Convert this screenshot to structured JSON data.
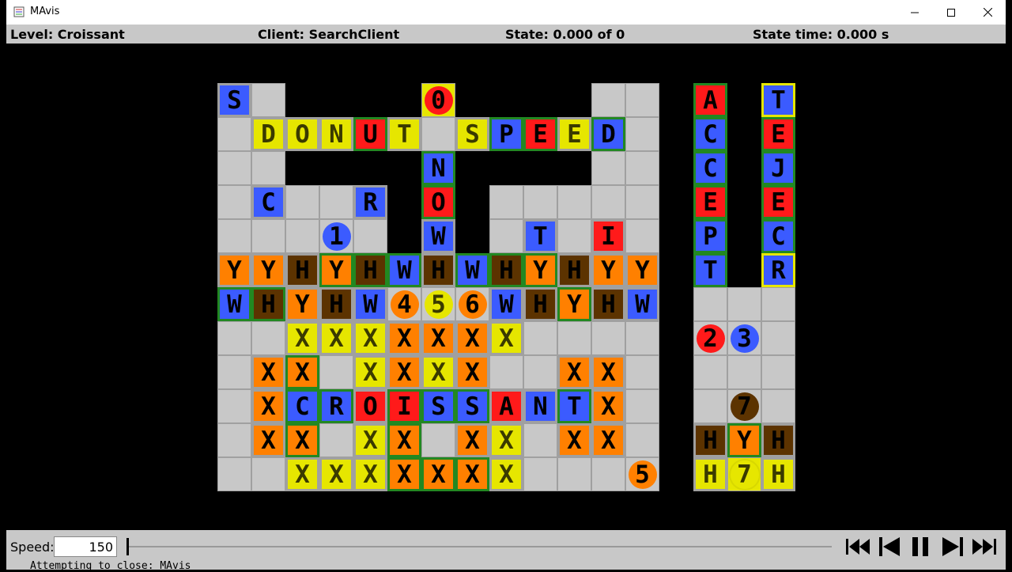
{
  "window": {
    "title": "MAvis",
    "minimize_symbol": "—",
    "maximize_symbol": "☐",
    "close_symbol": "✕"
  },
  "status": {
    "level": "Level: Croissant",
    "client": "Client: SearchClient",
    "state": "State: 0.000 of 0",
    "state_time": "State time: 0.000 s"
  },
  "controls": {
    "speed_label": "Speed:",
    "speed_value": "150",
    "slider_position": 0,
    "buttons": [
      "skip-to-start-icon",
      "step-back-icon",
      "pause-icon",
      "step-forward-icon",
      "skip-to-end-icon"
    ]
  },
  "console": {
    "text": "Attempting to close: MAvis"
  },
  "colors": {
    "free": "#c8c8c8",
    "wall": "#000000",
    "blue": "#3b5bff",
    "red": "#ff1a1a",
    "orange": "#ff8000",
    "yellow": "#e6e600",
    "brown": "#5c3300",
    "border_green": "#228822",
    "status_bar": "#c8c8c8"
  },
  "grid": {
    "rows": [
      "S....0....W...B..W",
      "DONUT.SPEED..C..E",
      "......N.......C..J",
      ".C..R.O.....E..E",
      "..1.W.TI.....P..C",
      "YYHYHWHWHYHYY.T..R",
      "WHYHW456WHYHW......",
      "..XXXXXXX.....23.",
      ".XX.XXXX..XX.......",
      ".XCROISSANTX...7.",
      ".XX.XX.XX.XX.HYH",
      "..XXXXXXX...5.H7H"
    ]
  },
  "boxes": [
    {
      "r": 0,
      "c": 0,
      "t": "S",
      "color": "blue",
      "goal": false
    },
    {
      "r": 1,
      "c": 1,
      "t": "D",
      "color": "yellow",
      "goal": false
    },
    {
      "r": 1,
      "c": 2,
      "t": "O",
      "color": "yellow",
      "goal": false
    },
    {
      "r": 1,
      "c": 3,
      "t": "N",
      "color": "yellow",
      "goal": false
    },
    {
      "r": 1,
      "c": 4,
      "t": "U",
      "color": "red",
      "goal": true
    },
    {
      "r": 1,
      "c": 5,
      "t": "T",
      "color": "yellow",
      "goal": false
    },
    {
      "r": 1,
      "c": 7,
      "t": "S",
      "color": "yellow",
      "goal": false
    },
    {
      "r": 1,
      "c": 8,
      "t": "P",
      "color": "blue",
      "goal": true
    },
    {
      "r": 1,
      "c": 9,
      "t": "E",
      "color": "red",
      "goal": true
    },
    {
      "r": 1,
      "c": 10,
      "t": "E",
      "color": "yellow",
      "goal": false
    },
    {
      "r": 1,
      "c": 11,
      "t": "D",
      "color": "blue",
      "goal": true
    },
    {
      "r": 2,
      "c": 6,
      "t": "N",
      "color": "blue",
      "goal": true
    },
    {
      "r": 3,
      "c": 1,
      "t": "C",
      "color": "blue",
      "goal": false
    },
    {
      "r": 3,
      "c": 4,
      "t": "R",
      "color": "blue",
      "goal": false
    },
    {
      "r": 3,
      "c": 6,
      "t": "O",
      "color": "red",
      "goal": true
    },
    {
      "r": 4,
      "c": 6,
      "t": "W",
      "color": "blue",
      "goal": false
    },
    {
      "r": 4,
      "c": 9,
      "t": "T",
      "color": "blue",
      "goal": false
    },
    {
      "r": 4,
      "c": 11,
      "t": "I",
      "color": "red",
      "goal": false
    },
    {
      "r": 5,
      "c": 0,
      "t": "Y",
      "color": "orange",
      "goal": false
    },
    {
      "r": 5,
      "c": 1,
      "t": "Y",
      "color": "orange",
      "goal": false
    },
    {
      "r": 5,
      "c": 2,
      "t": "H",
      "color": "brown",
      "goal": false
    },
    {
      "r": 5,
      "c": 3,
      "t": "Y",
      "color": "orange",
      "goal": true
    },
    {
      "r": 5,
      "c": 4,
      "t": "H",
      "color": "brown",
      "goal": true
    },
    {
      "r": 5,
      "c": 5,
      "t": "W",
      "color": "blue",
      "goal": true
    },
    {
      "r": 5,
      "c": 6,
      "t": "H",
      "color": "brown",
      "goal": false
    },
    {
      "r": 5,
      "c": 7,
      "t": "W",
      "color": "blue",
      "goal": true
    },
    {
      "r": 5,
      "c": 8,
      "t": "H",
      "color": "brown",
      "goal": true
    },
    {
      "r": 5,
      "c": 9,
      "t": "Y",
      "color": "orange",
      "goal": true
    },
    {
      "r": 5,
      "c": 10,
      "t": "H",
      "color": "brown",
      "goal": false
    },
    {
      "r": 5,
      "c": 11,
      "t": "Y",
      "color": "orange",
      "goal": false
    },
    {
      "r": 5,
      "c": 12,
      "t": "Y",
      "color": "orange",
      "goal": false
    },
    {
      "r": 6,
      "c": 0,
      "t": "W",
      "color": "blue",
      "goal": true
    },
    {
      "r": 6,
      "c": 1,
      "t": "H",
      "color": "brown",
      "goal": true
    },
    {
      "r": 6,
      "c": 2,
      "t": "Y",
      "color": "orange",
      "goal": false
    },
    {
      "r": 6,
      "c": 3,
      "t": "H",
      "color": "brown",
      "goal": false
    },
    {
      "r": 6,
      "c": 4,
      "t": "W",
      "color": "blue",
      "goal": false
    },
    {
      "r": 6,
      "c": 8,
      "t": "W",
      "color": "blue",
      "goal": false
    },
    {
      "r": 6,
      "c": 9,
      "t": "H",
      "color": "brown",
      "goal": false
    },
    {
      "r": 6,
      "c": 10,
      "t": "Y",
      "color": "orange",
      "goal": true
    },
    {
      "r": 6,
      "c": 11,
      "t": "H",
      "color": "brown",
      "goal": false
    },
    {
      "r": 6,
      "c": 12,
      "t": "W",
      "color": "blue",
      "goal": false
    },
    {
      "r": 7,
      "c": 2,
      "t": "X",
      "color": "yellow",
      "goal": false
    },
    {
      "r": 7,
      "c": 3,
      "t": "X",
      "color": "yellow",
      "goal": false
    },
    {
      "r": 7,
      "c": 4,
      "t": "X",
      "color": "yellow",
      "goal": false
    },
    {
      "r": 7,
      "c": 5,
      "t": "X",
      "color": "orange",
      "goal": false
    },
    {
      "r": 7,
      "c": 6,
      "t": "X",
      "color": "orange",
      "goal": false
    },
    {
      "r": 7,
      "c": 7,
      "t": "X",
      "color": "orange",
      "goal": false
    },
    {
      "r": 7,
      "c": 8,
      "t": "X",
      "color": "yellow",
      "goal": false
    },
    {
      "r": 8,
      "c": 1,
      "t": "X",
      "color": "orange",
      "goal": false
    },
    {
      "r": 8,
      "c": 2,
      "t": "X",
      "color": "orange",
      "goal": true
    },
    {
      "r": 8,
      "c": 4,
      "t": "X",
      "color": "yellow",
      "goal": false
    },
    {
      "r": 8,
      "c": 5,
      "t": "X",
      "color": "orange",
      "goal": false
    },
    {
      "r": 8,
      "c": 6,
      "t": "X",
      "color": "yellow",
      "goal": false
    },
    {
      "r": 8,
      "c": 7,
      "t": "X",
      "color": "orange",
      "goal": false
    },
    {
      "r": 8,
      "c": 10,
      "t": "X",
      "color": "orange",
      "goal": false
    },
    {
      "r": 8,
      "c": 11,
      "t": "X",
      "color": "orange",
      "goal": false
    },
    {
      "r": 9,
      "c": 1,
      "t": "X",
      "color": "orange",
      "goal": false
    },
    {
      "r": 9,
      "c": 2,
      "t": "C",
      "color": "blue",
      "goal": true
    },
    {
      "r": 9,
      "c": 3,
      "t": "R",
      "color": "blue",
      "goal": true
    },
    {
      "r": 9,
      "c": 4,
      "t": "O",
      "color": "red",
      "goal": false
    },
    {
      "r": 9,
      "c": 5,
      "t": "I",
      "color": "red",
      "goal": true
    },
    {
      "r": 9,
      "c": 6,
      "t": "S",
      "color": "blue",
      "goal": true
    },
    {
      "r": 9,
      "c": 7,
      "t": "S",
      "color": "blue",
      "goal": true
    },
    {
      "r": 9,
      "c": 8,
      "t": "A",
      "color": "red",
      "goal": false
    },
    {
      "r": 9,
      "c": 9,
      "t": "N",
      "color": "blue",
      "goal": false
    },
    {
      "r": 9,
      "c": 10,
      "t": "T",
      "color": "blue",
      "goal": true
    },
    {
      "r": 9,
      "c": 11,
      "t": "X",
      "color": "orange",
      "goal": false
    },
    {
      "r": 10,
      "c": 1,
      "t": "X",
      "color": "orange",
      "goal": false
    },
    {
      "r": 10,
      "c": 2,
      "t": "X",
      "color": "orange",
      "goal": true
    },
    {
      "r": 10,
      "c": 4,
      "t": "X",
      "color": "yellow",
      "goal": false
    },
    {
      "r": 10,
      "c": 5,
      "t": "X",
      "color": "orange",
      "goal": true
    },
    {
      "r": 10,
      "c": 7,
      "t": "X",
      "color": "orange",
      "goal": false
    },
    {
      "r": 10,
      "c": 8,
      "t": "X",
      "color": "yellow",
      "goal": false
    },
    {
      "r": 10,
      "c": 10,
      "t": "X",
      "color": "orange",
      "goal": false
    },
    {
      "r": 10,
      "c": 11,
      "t": "X",
      "color": "orange",
      "goal": false
    },
    {
      "r": 11,
      "c": 2,
      "t": "X",
      "color": "yellow",
      "goal": false
    },
    {
      "r": 11,
      "c": 3,
      "t": "X",
      "color": "yellow",
      "goal": false
    },
    {
      "r": 11,
      "c": 4,
      "t": "X",
      "color": "yellow",
      "goal": false
    },
    {
      "r": 11,
      "c": 5,
      "t": "X",
      "color": "orange",
      "goal": true
    },
    {
      "r": 11,
      "c": 6,
      "t": "X",
      "color": "orange",
      "goal": true
    },
    {
      "r": 11,
      "c": 7,
      "t": "X",
      "color": "orange",
      "goal": true
    },
    {
      "r": 11,
      "c": 8,
      "t": "X",
      "color": "yellow",
      "goal": false
    },
    {
      "r": 0,
      "c": 14,
      "t": "A",
      "color": "red",
      "goal": true
    },
    {
      "r": 0,
      "c": 16,
      "t": "T",
      "color": "blue",
      "goal": false,
      "yellowBorder": true
    },
    {
      "r": 1,
      "c": 14,
      "t": "C",
      "color": "blue",
      "goal": true
    },
    {
      "r": 1,
      "c": 16,
      "t": "E",
      "color": "red",
      "goal": true
    },
    {
      "r": 2,
      "c": 14,
      "t": "C",
      "color": "blue",
      "goal": true
    },
    {
      "r": 2,
      "c": 16,
      "t": "J",
      "color": "blue",
      "goal": true
    },
    {
      "r": 3,
      "c": 14,
      "t": "E",
      "color": "red",
      "goal": true
    },
    {
      "r": 3,
      "c": 16,
      "t": "E",
      "color": "red",
      "goal": true
    },
    {
      "r": 4,
      "c": 14,
      "t": "P",
      "color": "blue",
      "goal": true
    },
    {
      "r": 4,
      "c": 16,
      "t": "C",
      "color": "blue",
      "goal": true
    },
    {
      "r": 5,
      "c": 14,
      "t": "T",
      "color": "blue",
      "goal": true
    },
    {
      "r": 5,
      "c": 16,
      "t": "R",
      "color": "blue",
      "goal": false,
      "yellowBorder": true
    },
    {
      "r": 10,
      "c": 14,
      "t": "H",
      "color": "brown",
      "goal": false
    },
    {
      "r": 10,
      "c": 15,
      "t": "Y",
      "color": "orange",
      "goal": true
    },
    {
      "r": 10,
      "c": 16,
      "t": "H",
      "color": "brown",
      "goal": false
    },
    {
      "r": 11,
      "c": 14,
      "t": "H",
      "color": "yellow",
      "goal": false
    },
    {
      "r": 11,
      "c": 16,
      "t": "H",
      "color": "yellow",
      "goal": false
    }
  ],
  "agents": [
    {
      "r": 0,
      "c": 6,
      "t": "0",
      "color": "red",
      "bg": "yellow"
    },
    {
      "r": 4,
      "c": 3,
      "t": "1",
      "color": "blue",
      "bg": "free"
    },
    {
      "r": 6,
      "c": 5,
      "t": "4",
      "color": "orange",
      "bg": "free"
    },
    {
      "r": 6,
      "c": 6,
      "t": "5",
      "color": "yellow",
      "bg": "free"
    },
    {
      "r": 6,
      "c": 7,
      "t": "6",
      "color": "orange",
      "bg": "free"
    },
    {
      "r": 11,
      "c": 12,
      "t": "5",
      "color": "orange",
      "bg": "free"
    },
    {
      "r": 7,
      "c": 14,
      "t": "2",
      "color": "red",
      "bg": "free"
    },
    {
      "r": 7,
      "c": 15,
      "t": "3",
      "color": "blue",
      "bg": "free"
    },
    {
      "r": 9,
      "c": 15,
      "t": "7",
      "color": "brown",
      "bg": "free"
    },
    {
      "r": 11,
      "c": 15,
      "t": "7",
      "color": "yellow",
      "bg": "yellow"
    }
  ],
  "free_cells": [
    [
      0,
      0
    ],
    [
      0,
      1
    ],
    [
      0,
      6
    ],
    [
      0,
      11
    ],
    [
      0,
      12
    ],
    [
      0,
      14
    ],
    [
      0,
      16
    ],
    [
      1,
      0
    ],
    [
      1,
      6
    ],
    [
      1,
      12
    ],
    [
      1,
      14
    ],
    [
      1,
      16
    ],
    [
      2,
      0
    ],
    [
      2,
      1
    ],
    [
      2,
      11
    ],
    [
      2,
      12
    ],
    [
      2,
      14
    ],
    [
      2,
      16
    ],
    [
      3,
      0
    ],
    [
      3,
      2
    ],
    [
      3,
      3
    ],
    [
      3,
      8
    ],
    [
      3,
      9
    ],
    [
      3,
      10
    ],
    [
      3,
      11
    ],
    [
      3,
      12
    ],
    [
      3,
      14
    ],
    [
      3,
      16
    ],
    [
      4,
      0
    ],
    [
      4,
      1
    ],
    [
      4,
      2
    ],
    [
      4,
      4
    ],
    [
      4,
      8
    ],
    [
      4,
      10
    ],
    [
      4,
      12
    ],
    [
      4,
      14
    ],
    [
      4,
      16
    ],
    [
      6,
      14
    ],
    [
      6,
      15
    ],
    [
      6,
      16
    ],
    [
      7,
      0
    ],
    [
      7,
      1
    ],
    [
      7,
      9
    ],
    [
      7,
      10
    ],
    [
      7,
      11
    ],
    [
      7,
      12
    ],
    [
      7,
      16
    ],
    [
      8,
      0
    ],
    [
      8,
      3
    ],
    [
      8,
      8
    ],
    [
      8,
      9
    ],
    [
      8,
      12
    ],
    [
      8,
      14
    ],
    [
      8,
      15
    ],
    [
      8,
      16
    ],
    [
      9,
      0
    ],
    [
      9,
      12
    ],
    [
      9,
      14
    ],
    [
      9,
      16
    ],
    [
      10,
      0
    ],
    [
      10,
      3
    ],
    [
      10,
      6
    ],
    [
      10,
      9
    ],
    [
      10,
      12
    ],
    [
      11,
      0
    ],
    [
      11,
      1
    ],
    [
      11,
      9
    ],
    [
      11,
      10
    ],
    [
      11,
      11
    ]
  ]
}
